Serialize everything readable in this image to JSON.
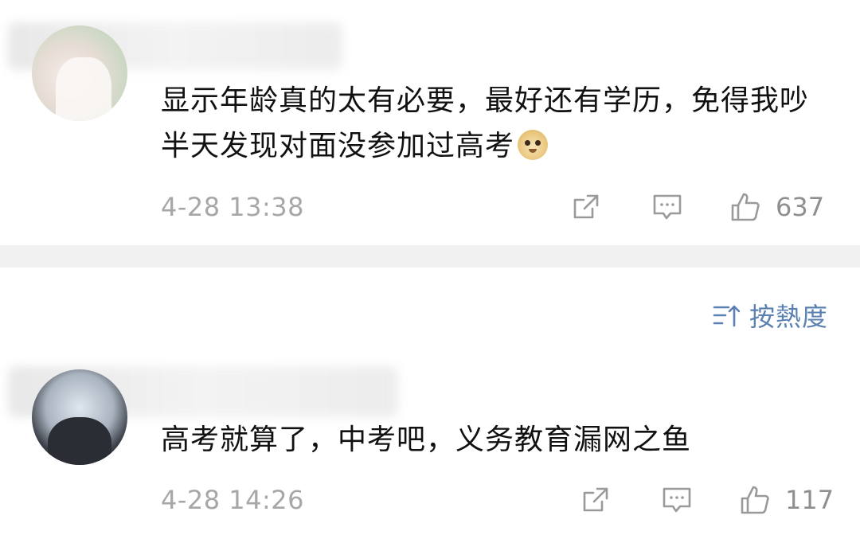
{
  "comments": [
    {
      "text": "显示年龄真的太有必要，最好还有学历，免得我吵半天发现对面没参加过高考",
      "emoji": "doge-emoji",
      "timestamp": "4-28 13:38",
      "likes": "637"
    },
    {
      "text": "高考就算了，中考吧，义务教育漏网之鱼",
      "timestamp": "4-28 14:26",
      "likes": "117"
    }
  ],
  "sort": {
    "label": "按熱度",
    "icon": "sort-icon"
  },
  "colors": {
    "text": "#111111",
    "meta": "#a7a7a7",
    "icon": "#9a9a9a",
    "sort_accent": "#5b80b2",
    "divider": "#f1f1f1"
  },
  "icons": {
    "share": "share-icon",
    "comment": "comment-icon",
    "like": "thumbs-up-icon"
  }
}
